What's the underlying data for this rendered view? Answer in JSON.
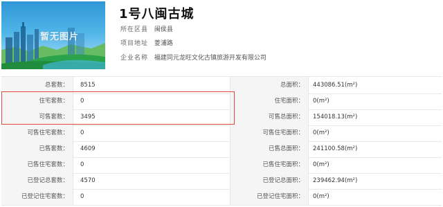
{
  "project": {
    "title": "1号八闽古城",
    "thumbnail_label": "暂无图片",
    "info": [
      {
        "label": "所在区县",
        "value": "闽侯县"
      },
      {
        "label": "项目地址",
        "value": "菱浦路"
      },
      {
        "label": "企业名称",
        "value": "福建同元龙旺文化古镇旅游开发有限公司"
      }
    ]
  },
  "stats": [
    {
      "left_label": "总套数：",
      "left_value": "8515",
      "right_label": "总面积：",
      "right_value": "443086.51(m²)"
    },
    {
      "left_label": "住宅套数：",
      "left_value": "0",
      "right_label": "住宅面积：",
      "right_value": "0(m²)"
    },
    {
      "left_label": "可售套数：",
      "left_value": "3495",
      "right_label": "可售总面积：",
      "right_value": "154018.13(m²)"
    },
    {
      "left_label": "可售住宅套数：",
      "left_value": "0",
      "right_label": "可售住宅面积：",
      "right_value": "0(m²)"
    },
    {
      "left_label": "已售套数：",
      "left_value": "4609",
      "right_label": "已售总面积：",
      "right_value": "241100.58(m²)"
    },
    {
      "left_label": "已售住宅套数：",
      "left_value": "0",
      "right_label": "已售住宅面积：",
      "right_value": "0(m²)"
    },
    {
      "left_label": "已登记总套数：",
      "left_value": "4570",
      "right_label": "已登记总面积：",
      "right_value": "239462.94(m²)"
    },
    {
      "left_label": "已登记住宅套数：",
      "left_value": "0",
      "right_label": "已登记住宅面积：",
      "right_value": "0(m²)"
    }
  ],
  "colors": {
    "highlight_border": "#e0483d",
    "label_background": "#f5f5f5"
  }
}
